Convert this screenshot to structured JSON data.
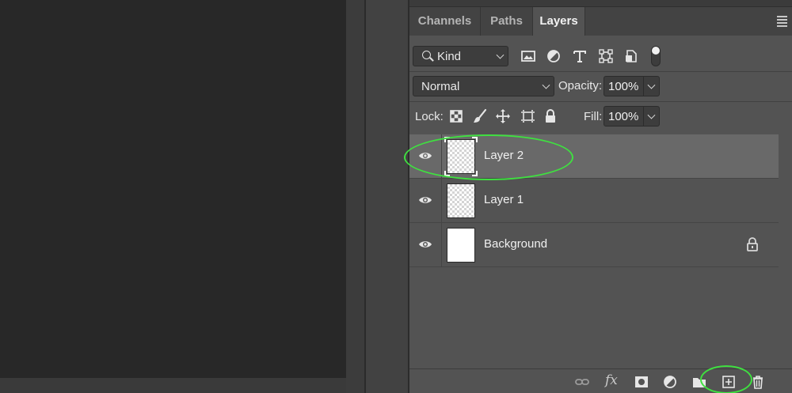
{
  "tabs": [
    {
      "label": "Channels",
      "active": false
    },
    {
      "label": "Paths",
      "active": false
    },
    {
      "label": "Layers",
      "active": true
    }
  ],
  "filter": {
    "kind_label": "Kind",
    "icons": [
      "image-filter-icon",
      "adjustment-filter-icon",
      "type-filter-icon",
      "shape-filter-icon",
      "smart-object-filter-icon"
    ]
  },
  "blend": {
    "mode": "Normal",
    "opacity_label": "Opacity:",
    "opacity_value": "100%"
  },
  "lock": {
    "label": "Lock:",
    "fill_label": "Fill:",
    "fill_value": "100%",
    "icons": [
      "lock-transparent-pixels-icon",
      "lock-image-pixels-icon",
      "lock-position-icon",
      "lock-artboard-icon",
      "lock-all-icon"
    ]
  },
  "layers": [
    {
      "name": "Layer 2",
      "selected": true,
      "visible": true,
      "thumbnail": "transparent",
      "locked": false
    },
    {
      "name": "Layer 1",
      "selected": false,
      "visible": true,
      "thumbnail": "transparent",
      "locked": false
    },
    {
      "name": "Background",
      "selected": false,
      "visible": true,
      "thumbnail": "white",
      "locked": true
    }
  ],
  "bottom_toolbar": {
    "fx_label": "fx",
    "icons": [
      "link-layers-icon",
      "layer-style-icon",
      "layer-mask-icon",
      "adjustment-layer-icon",
      "new-group-icon",
      "new-layer-icon",
      "delete-layer-icon"
    ]
  },
  "colors": {
    "panel_bg": "#535353",
    "selected_row": "#696969",
    "annotation": "#3fe040"
  }
}
